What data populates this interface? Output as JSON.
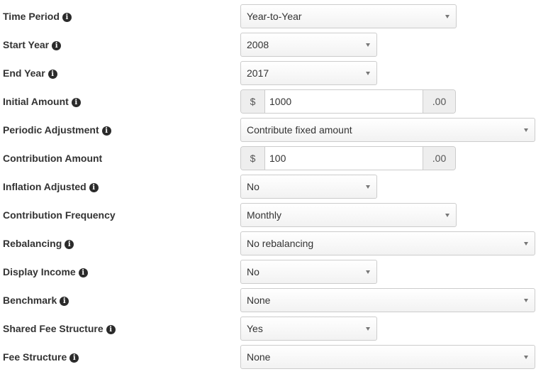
{
  "fields": {
    "time_period": {
      "label": "Time Period",
      "value": "Year-to-Year"
    },
    "start_year": {
      "label": "Start Year",
      "value": "2008"
    },
    "end_year": {
      "label": "End Year",
      "value": "2017"
    },
    "initial_amount": {
      "label": "Initial Amount",
      "prefix": "$",
      "value": "1000",
      "suffix": ".00"
    },
    "periodic_adjustment": {
      "label": "Periodic Adjustment",
      "value": "Contribute fixed amount"
    },
    "contribution_amount": {
      "label": "Contribution Amount",
      "prefix": "$",
      "value": "100",
      "suffix": ".00"
    },
    "inflation_adjusted": {
      "label": "Inflation Adjusted",
      "value": "No"
    },
    "contribution_frequency": {
      "label": "Contribution Frequency",
      "value": "Monthly"
    },
    "rebalancing": {
      "label": "Rebalancing",
      "value": "No rebalancing"
    },
    "display_income": {
      "label": "Display Income",
      "value": "No"
    },
    "benchmark": {
      "label": "Benchmark",
      "value": "None"
    },
    "shared_fee_structure": {
      "label": "Shared Fee Structure",
      "value": "Yes"
    },
    "fee_structure": {
      "label": "Fee Structure",
      "value": "None"
    }
  },
  "icons": {
    "info": "info-circle-icon",
    "caret": "caret-down-icon"
  },
  "colors": {
    "label_text": "#333333",
    "border": "#cccccc",
    "addon_bg": "#eeeeee",
    "info_icon": "#2b2b2b"
  }
}
